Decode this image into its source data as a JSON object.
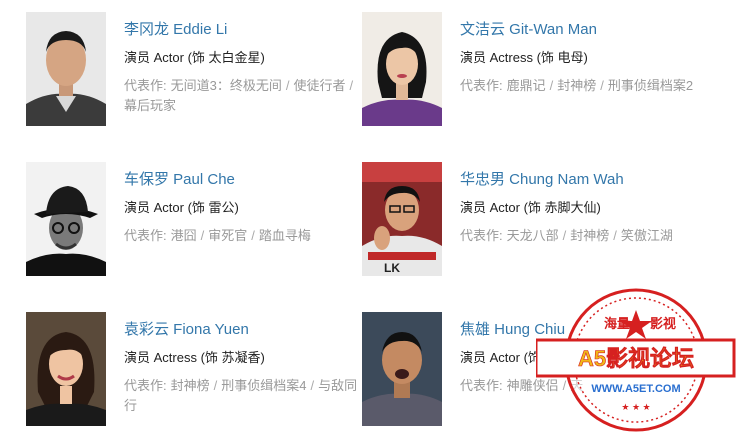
{
  "cast": [
    {
      "name": "李冈龙 Eddie Li",
      "role": "演员 Actor (饰 太白金星)",
      "works_label": "代表作:",
      "works": [
        "无间道3：终极无间",
        "使徒行者",
        "幕后玩家"
      ]
    },
    {
      "name": "文洁云 Git-Wan Man",
      "role": "演员 Actress (饰 电母)",
      "works_label": "代表作:",
      "works": [
        "鹿鼎记",
        "封神榜",
        "刑事侦缉档案2"
      ]
    },
    {
      "name": "车保罗 Paul Che",
      "role": "演员 Actor (饰 雷公)",
      "works_label": "代表作:",
      "works": [
        "港囧",
        "审死官",
        "踏血寻梅"
      ]
    },
    {
      "name": "华忠男 Chung Nam Wah",
      "role": "演员 Actor (饰 赤脚大仙)",
      "works_label": "代表作:",
      "works": [
        "天龙八部",
        "封神榜",
        "笑傲江湖"
      ]
    },
    {
      "name": "袁彩云 Fiona Yuen",
      "role": "演员 Actress (饰 苏凝香)",
      "works_label": "代表作:",
      "works": [
        "封神榜",
        "刑事侦缉档案4",
        "与敌同行"
      ]
    },
    {
      "name": "焦雄 Hung Chiu",
      "role": "演员 Actor (饰 主持)",
      "works_label": "代表作:",
      "works": [
        "神雕侠侣",
        "天"
      ]
    }
  ],
  "watermark": {
    "top": "海量",
    "right": "影视",
    "main": "A5影视论坛",
    "url": "WWW.A5ET.COM"
  },
  "colors": {
    "link": "#3377aa",
    "text": "#222222",
    "muted": "#999999",
    "stamp": "#d62020"
  }
}
